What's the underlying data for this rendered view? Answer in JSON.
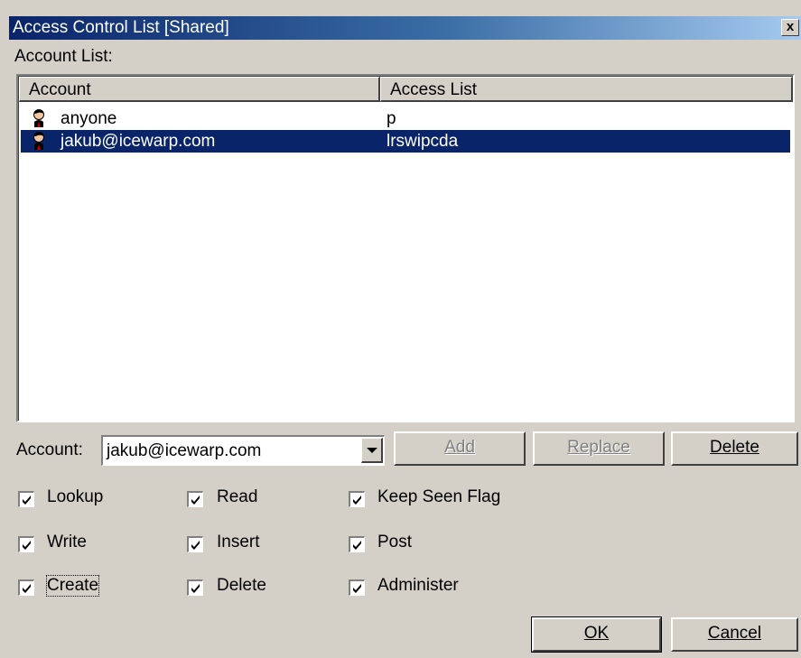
{
  "window": {
    "title": "Access Control List [Shared]",
    "close_glyph": "x"
  },
  "account_list_label": "Account List:",
  "list": {
    "columns": [
      "Account",
      "Access List"
    ],
    "rows": [
      {
        "account": "anyone",
        "access": "p",
        "icon": "user-icon",
        "selected": false
      },
      {
        "account": "jakub@icewarp.com",
        "access": "lrswipcda",
        "icon": "user-icon",
        "selected": true
      }
    ]
  },
  "account_field": {
    "label": "Account:",
    "value": "jakub@icewarp.com"
  },
  "buttons": {
    "add": "Add",
    "replace": "Replace",
    "delete": "Delete",
    "ok": "OK",
    "cancel": "Cancel"
  },
  "permissions": [
    {
      "label": "Lookup",
      "checked": true
    },
    {
      "label": "Read",
      "checked": true
    },
    {
      "label": "Keep Seen Flag",
      "checked": true
    },
    {
      "label": "Write",
      "checked": true
    },
    {
      "label": "Insert",
      "checked": true
    },
    {
      "label": "Post",
      "checked": true
    },
    {
      "label": "Create",
      "checked": true
    },
    {
      "label": "Delete",
      "checked": true
    },
    {
      "label": "Administer",
      "checked": true
    }
  ],
  "colors": {
    "title_start": "#0a246a",
    "title_end": "#a6caf0",
    "selection": "#0a246a",
    "face": "#d4d0c8"
  }
}
